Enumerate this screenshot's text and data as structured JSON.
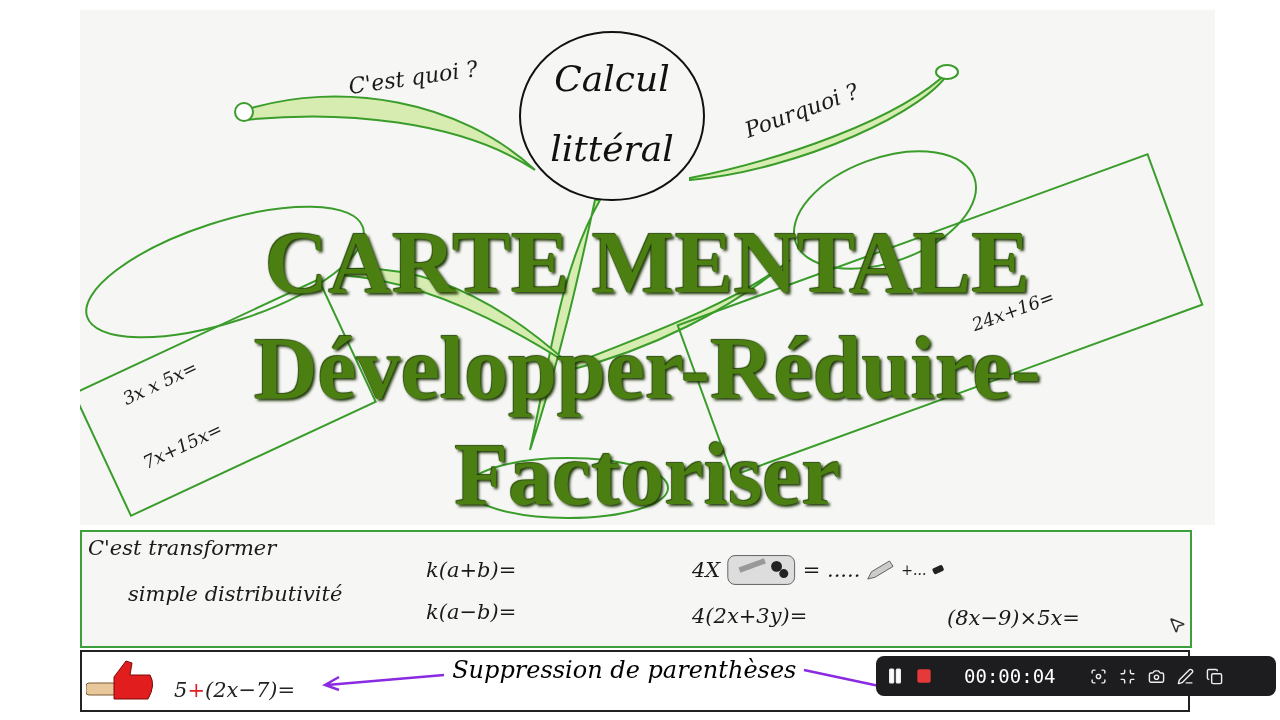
{
  "mind_map": {
    "center": "Calcul littéral",
    "labels": [
      {
        "text": "C'est quoi ?",
        "kind": "label"
      },
      {
        "text": "Pourquoi ?",
        "kind": "label"
      },
      {
        "text": "3x x 5x=",
        "kind": "formula"
      },
      {
        "text": "7x+15x=",
        "kind": "formula"
      },
      {
        "text": "24x+16=",
        "kind": "formula"
      }
    ]
  },
  "title": [
    "CARTE MENTALE",
    "Développer-Réduire-",
    "Factoriser"
  ],
  "definition_box": {
    "lines": [
      "C'est transformer",
      "simple distributivité"
    ],
    "formulas": [
      "k(a+b)=",
      "k(a−b)=",
      "4(2x+3y)=",
      "(8x−9)×5x="
    ],
    "pencil_case": {
      "factor": "4X",
      "equals": "= .....",
      "plus": "+..."
    }
  },
  "strip": {
    "expression": [
      {
        "text": "5",
        "color": "#222222"
      },
      {
        "text": "+",
        "color": "#e02020"
      },
      {
        "text": "(2x−7)=",
        "color": "#222222"
      }
    ],
    "caption": "Suppression de parenthèses"
  },
  "recorder": {
    "time": "00:00:04"
  }
}
